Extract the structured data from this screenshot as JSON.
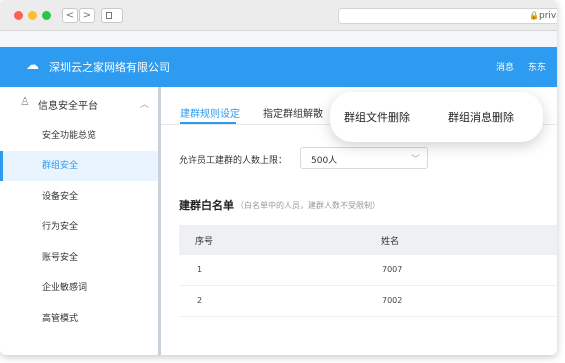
{
  "browser": {
    "address": "priva",
    "back": "<",
    "forward": ">"
  },
  "header": {
    "org_name": "深圳云之家网络有限公司",
    "messages": "消息",
    "user": "东东"
  },
  "sidebar": {
    "title": "信息安全平台",
    "items": [
      {
        "label": "安全功能总览"
      },
      {
        "label": "群组安全"
      },
      {
        "label": "设备安全"
      },
      {
        "label": "行为安全"
      },
      {
        "label": "账号安全"
      },
      {
        "label": "企业敏感词"
      },
      {
        "label": "高管模式"
      }
    ]
  },
  "tabs": [
    {
      "label": "建群规则设定"
    },
    {
      "label": "指定群组解散"
    }
  ],
  "popup": {
    "item1": "群组文件删除",
    "item2": "群组消息删除"
  },
  "limit": {
    "label": "允许员工建群的人数上限：",
    "value": "500人"
  },
  "whitelist": {
    "title": "建群白名单",
    "note": "（白名单中的人员，建群人数不受限制）",
    "columns": [
      "序号",
      "姓名"
    ],
    "rows": [
      {
        "index": "1",
        "name": "7007"
      },
      {
        "index": "2",
        "name": "7002"
      }
    ]
  },
  "colors": {
    "accent": "#2d9bf0"
  }
}
